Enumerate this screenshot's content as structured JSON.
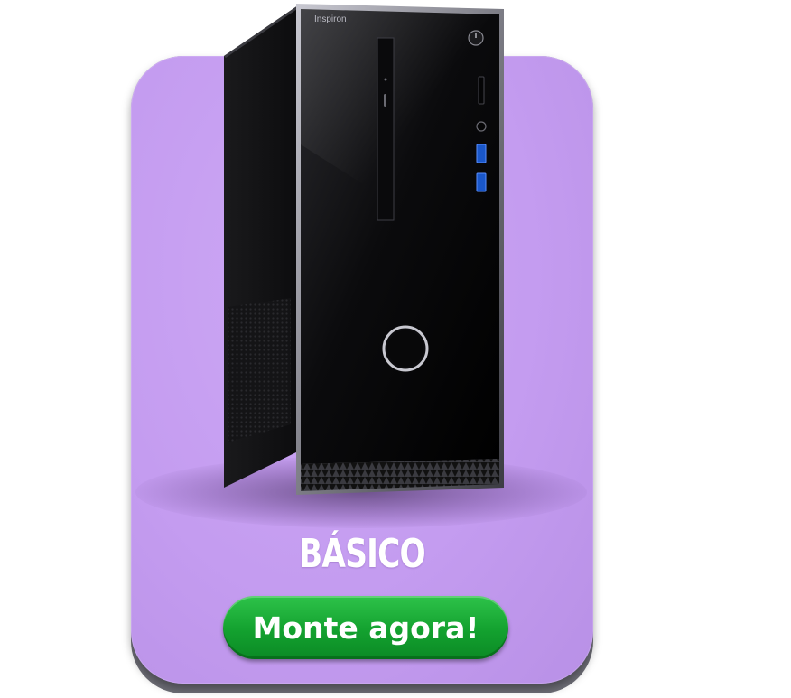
{
  "product": {
    "brand_label": "Inspiron",
    "category_label": "BÁSICO",
    "cta_label": "Monte agora!"
  },
  "colors": {
    "card_background": "#c49cf0",
    "cta_background": "#13a12f",
    "text": "#ffffff"
  }
}
